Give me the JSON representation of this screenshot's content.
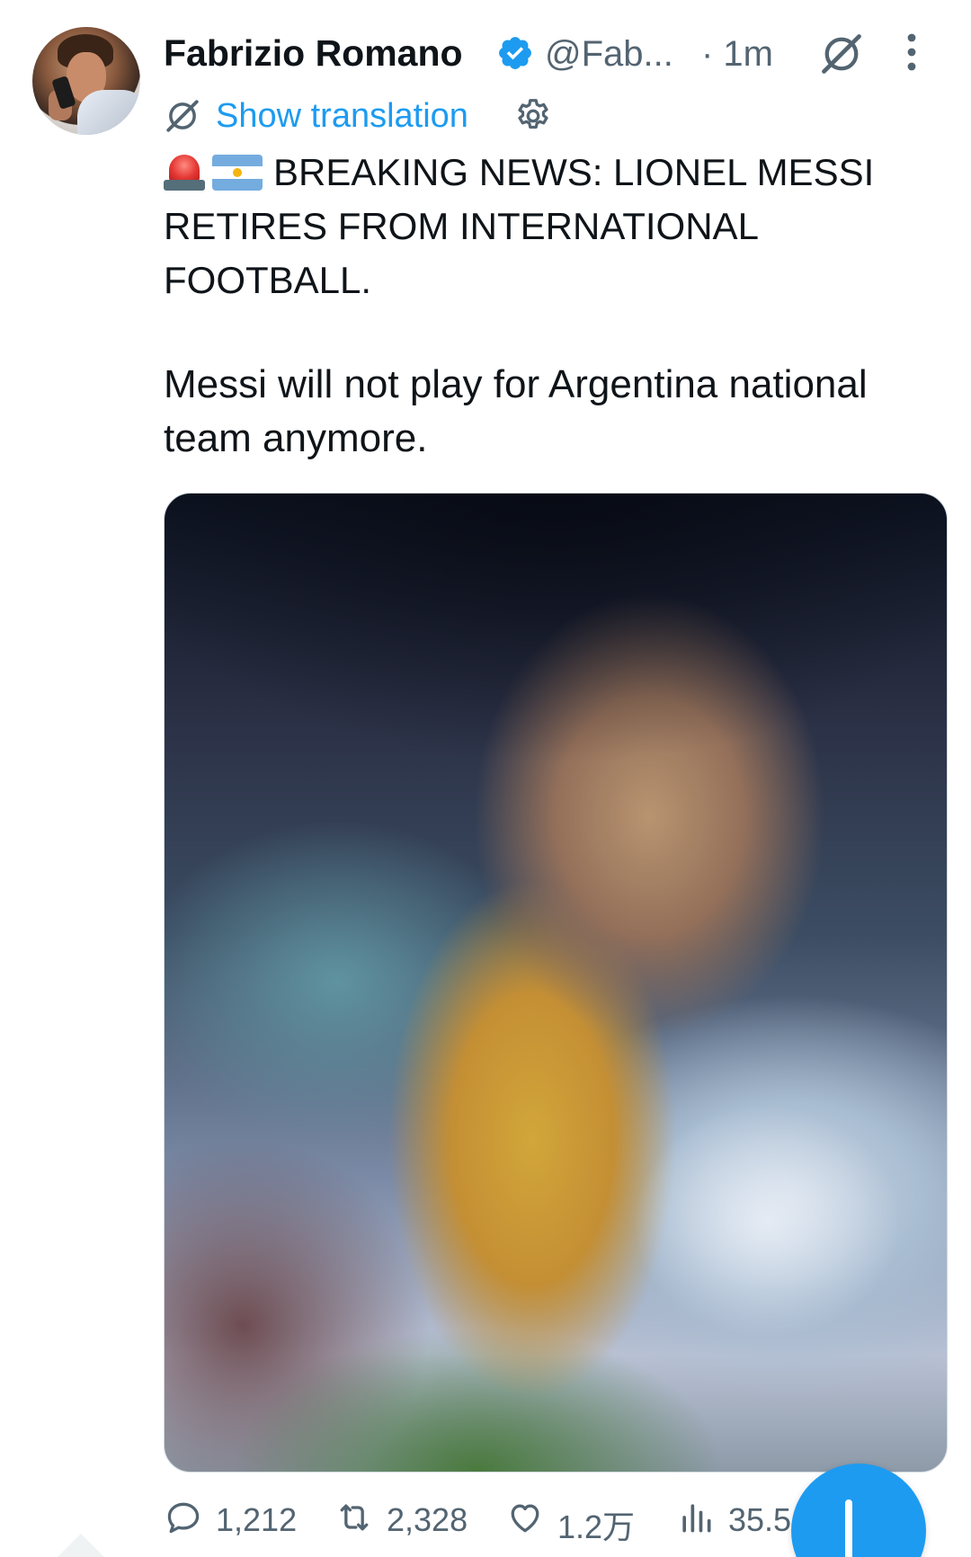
{
  "tweet": {
    "author": {
      "name": "Fabrizio Romano",
      "handle": "@Fab...",
      "verified": true,
      "avatar_icon": "avatar-photo"
    },
    "time": "· 1m",
    "translation_label": "Show translation",
    "text": {
      "emojis": [
        "police-car-light-emoji",
        "argentina-flag-emoji"
      ],
      "line1": "BREAKING NEWS: LIONEL MESSI",
      "line2": "RETIRES FROM INTERNATIONAL",
      "line3": "FOOTBALL.",
      "para2_line1": "Messi will not play for Argentina national",
      "para2_line2": "team anymore."
    },
    "media": {
      "type": "image",
      "blurred": true
    },
    "stats": {
      "replies": "1,212",
      "retweets": "2,328",
      "likes": "1.2万",
      "views": "35.5"
    }
  },
  "colors": {
    "accent": "#1d9bf0",
    "text": "#0f1419",
    "secondary": "#536471"
  }
}
